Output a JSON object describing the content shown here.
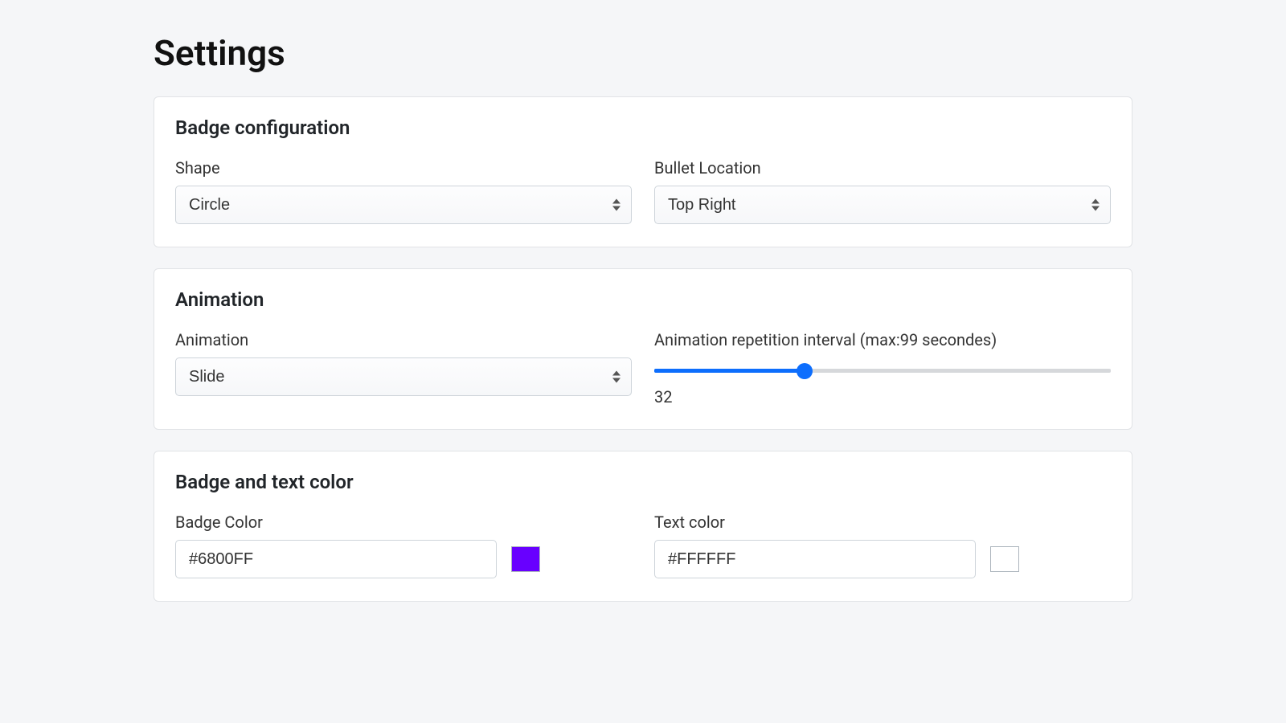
{
  "page": {
    "title": "Settings"
  },
  "badgeConfig": {
    "title": "Badge configuration",
    "shape": {
      "label": "Shape",
      "value": "Circle"
    },
    "bulletLocation": {
      "label": "Bullet Location",
      "value": "Top Right"
    }
  },
  "animation": {
    "title": "Animation",
    "type": {
      "label": "Animation",
      "value": "Slide"
    },
    "interval": {
      "label": "Animation repetition interval (max:99 secondes)",
      "value": 32,
      "max": 99
    }
  },
  "colors": {
    "title": "Badge and text color",
    "badge": {
      "label": "Badge Color",
      "value": "#6800FF",
      "swatch": "#6800FF"
    },
    "text": {
      "label": "Text color",
      "value": "#FFFFFF",
      "swatch": "#FFFFFF"
    }
  }
}
